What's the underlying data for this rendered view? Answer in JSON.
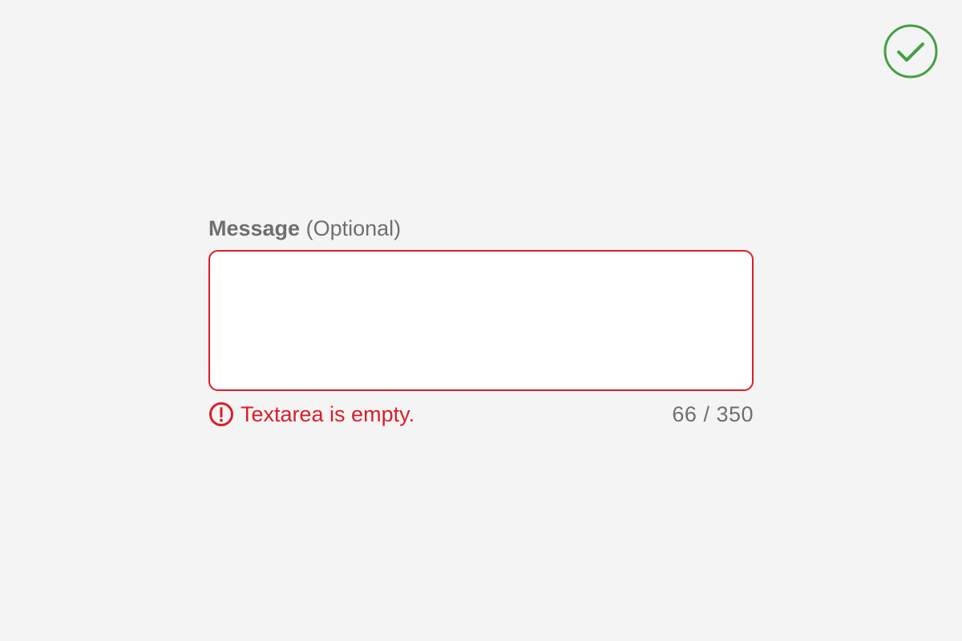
{
  "status": {
    "icon": "check-circle-icon",
    "color": "#42a042"
  },
  "field": {
    "label": "Message",
    "optional_text": "(Optional)",
    "value": "",
    "error_icon": "error-circle-icon",
    "error_text": "Textarea is empty.",
    "counter_text": "66 / 350"
  },
  "colors": {
    "background": "#f4f4f4",
    "error": "#da1e28",
    "label": "#6f6f6f",
    "textarea_bg": "#ffffff"
  }
}
